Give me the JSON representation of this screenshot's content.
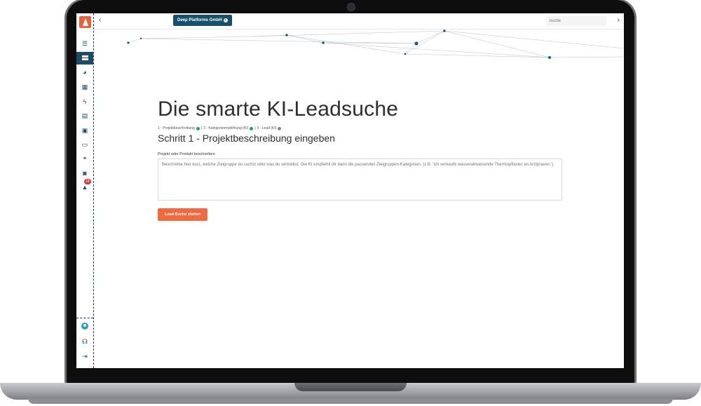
{
  "topbar": {
    "company": "Deep Platforms GmbH",
    "search_placeholder": "Suche"
  },
  "sidebar": {
    "notification_count": "18"
  },
  "main": {
    "title": "Die smarte KI-Leadsuche",
    "steps": [
      "1 - Projektbeschreibung",
      "2 - Kategorieempfehlung (KI)",
      "3 - Lead (KI)"
    ],
    "heading": "Schritt 1 - Projektbeschreibung eingeben",
    "field_label": "Projekt oder Produkt beschreiben",
    "textarea_placeholder": "Beschreibe hier kurz, welche Zielgruppe du suchst oder was du vertreibst. Die KI empfiehlt dir dann die passenden Zielgruppen-Kategorien. (z.B. 'Ich verkaufe wasserabweisende Thermopflaster an Arztpraxen.')",
    "start_button": "Lead-Suche starten"
  },
  "colors": {
    "accent": "#ef6a40",
    "primary": "#164f6a"
  }
}
